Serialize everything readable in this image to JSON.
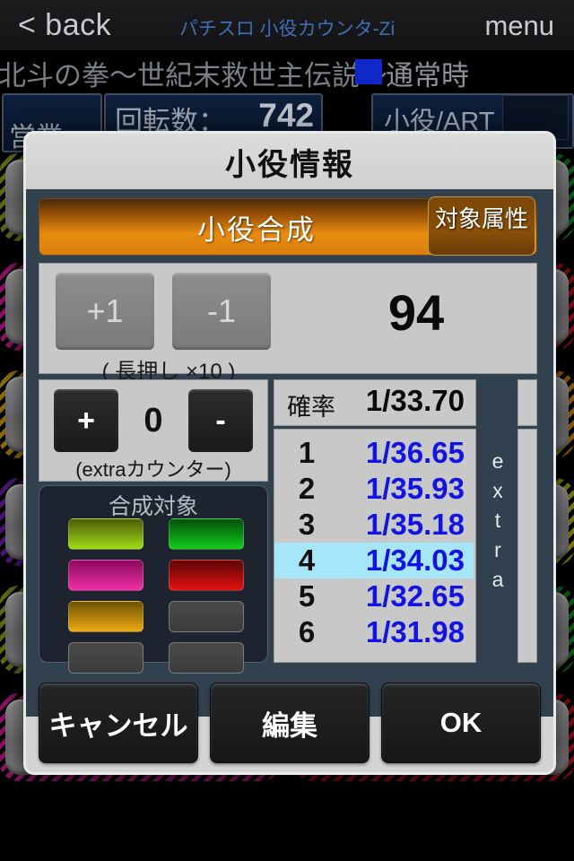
{
  "navbar": {
    "back_label": "< back",
    "app_title": "パチスロ 小役カウンタ-Zi",
    "menu_label": "menu"
  },
  "machine_bar": {
    "machine_name": "北斗の拳〜世紀末救世主伝説〜",
    "state_label": "通常時",
    "state_color": "#0f28c8"
  },
  "info_panels": {
    "left_label": "営業",
    "rotation_label": "回転数：",
    "rotation_value": "742",
    "koyaku_label": "小役/ART"
  },
  "dialog": {
    "title": "小役情報",
    "mode": {
      "label": "小役合成",
      "attr_button_label": "対象属性",
      "accent_color": "#e98b10"
    },
    "counter": {
      "plus_label": "+1",
      "minus_label": "-1",
      "value": "94",
      "note": "( 長押し ×10 )"
    },
    "extra_counter": {
      "plus_label": "+",
      "minus_label": "-",
      "value": "0",
      "note": "(extraカウンター)"
    },
    "target_panel": {
      "title": "合成対象",
      "swatches": [
        {
          "name": "yellow-green",
          "active": true,
          "color_top": "#4e5a06",
          "color_bottom": "#9ede17"
        },
        {
          "name": "green",
          "active": true,
          "color_top": "#044f07",
          "color_bottom": "#12cc1e"
        },
        {
          "name": "magenta",
          "active": true,
          "color_top": "#8a0a5e",
          "color_bottom": "#ef30a6"
        },
        {
          "name": "red",
          "active": true,
          "color_top": "#5c0505",
          "color_bottom": "#e41010"
        },
        {
          "name": "gold",
          "active": true,
          "color_top": "#6d5202",
          "color_bottom": "#edab12"
        },
        {
          "name": "empty-1",
          "active": false,
          "color_top": "#4a4a4a",
          "color_bottom": "#3c3c3c"
        },
        {
          "name": "empty-2",
          "active": false,
          "color_top": "#4a4a4a",
          "color_bottom": "#3c3c3c"
        },
        {
          "name": "empty-3",
          "active": false,
          "color_top": "#4a4a4a",
          "color_bottom": "#3c3c3c"
        }
      ]
    },
    "probability": {
      "header_label": "確率",
      "header_value": "1/33.70",
      "selected_index": 4,
      "rows": [
        {
          "index": "1",
          "value": "1/36.65"
        },
        {
          "index": "2",
          "value": "1/35.93"
        },
        {
          "index": "3",
          "value": "1/35.18"
        },
        {
          "index": "4",
          "value": "1/34.03"
        },
        {
          "index": "5",
          "value": "1/32.65"
        },
        {
          "index": "6",
          "value": "1/31.98"
        }
      ],
      "highlight_color": "#a6e6f9",
      "value_color": "#1414e0"
    },
    "extra_strip_label": "extra",
    "footer": {
      "cancel_label": "キャンセル",
      "edit_label": "編集",
      "ok_label": "OK"
    }
  },
  "background_rows": [
    {
      "frame_color": "#5a6b14"
    },
    {
      "frame_color": "#8d1266"
    },
    {
      "frame_color": "#8a6c0b"
    },
    {
      "frame_color": "#4b1570"
    }
  ],
  "background_rows_right": [
    {
      "frame_color": "#0d5a18"
    },
    {
      "frame_color": "#7a0d10"
    },
    {
      "frame_color": "#8a5a0b"
    },
    {
      "frame_color": "#7a7a10"
    }
  ]
}
